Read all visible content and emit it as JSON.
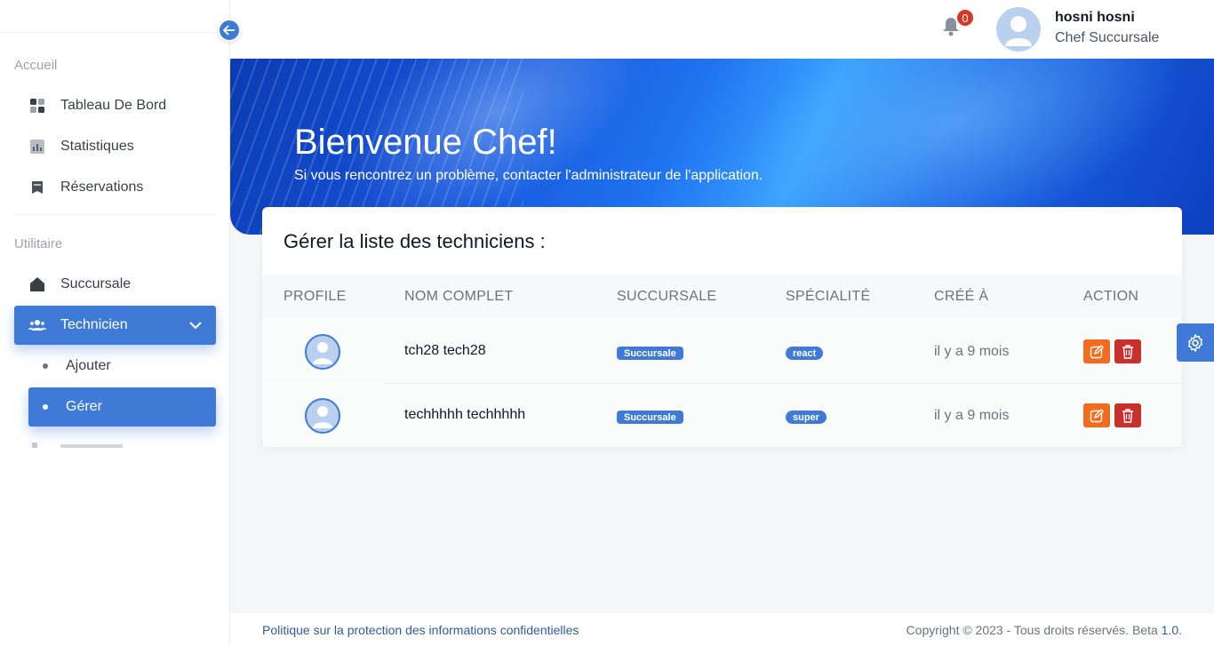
{
  "sidebar": {
    "section_home": "Accueil",
    "section_utility": "Utilitaire",
    "items": {
      "dashboard": "Tableau De Bord",
      "stats": "Statistiques",
      "reservations": "Réservations",
      "branch": "Succursale",
      "technician": "Technicien",
      "add": "Ajouter",
      "manage": "Gérer"
    }
  },
  "header": {
    "notifications_count": "0",
    "user_name": "hosni hosni",
    "user_role": "Chef Succursale"
  },
  "banner": {
    "title": "Bienvenue Chef!",
    "subtitle": "Si vous rencontrez un problème, contacter l'administrateur de l'application."
  },
  "card": {
    "title": "Gérer la liste des techniciens :",
    "columns": [
      "PROFILE",
      "NOM COMPLET",
      "SUCCURSALE",
      "SPÉCIALITÉ",
      "CRÉÉ À",
      "ACTION"
    ],
    "rows": [
      {
        "name": "tch28 tech28",
        "branch": "Succursale",
        "specialty": "react",
        "created": "il y a 9 mois"
      },
      {
        "name": "techhhhh techhhhh",
        "branch": "Succursale",
        "specialty": "super",
        "created": "il y a 9 mois"
      }
    ]
  },
  "footer": {
    "privacy_link": "Politique sur la protection des informations confidentielles",
    "copyright": "Copyright © 2023 - Tous droits réservés. Beta ",
    "version": "1.0."
  },
  "colors": {
    "primary": "#3f7bd6",
    "edit": "#f26c1d",
    "delete": "#c9302c",
    "badge_notification": "#d43a2a"
  }
}
